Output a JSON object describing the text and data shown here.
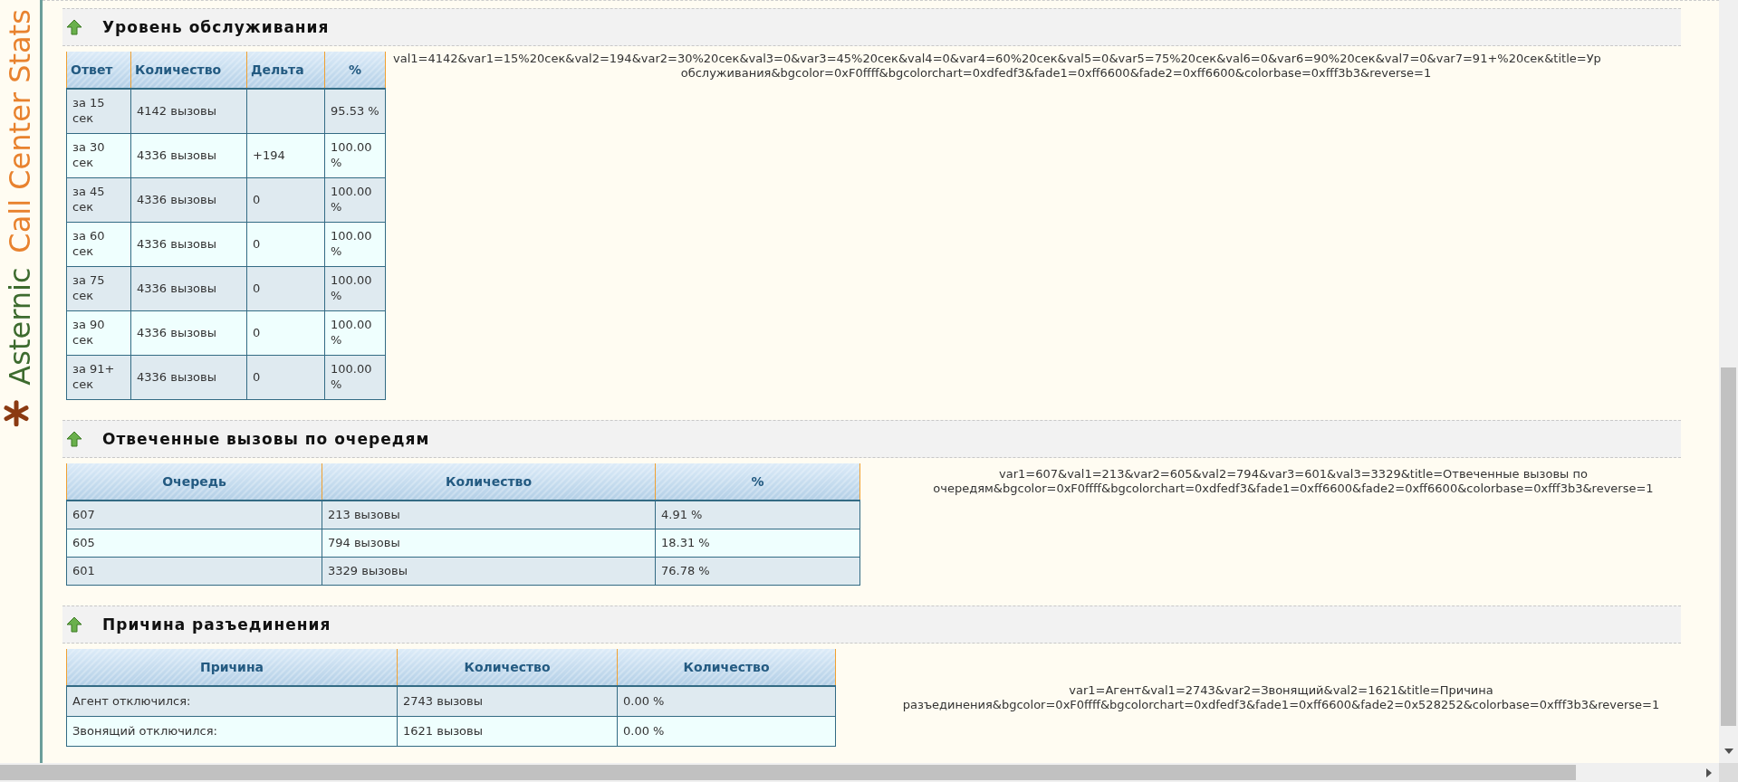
{
  "logo": {
    "brand": "Asternic",
    "product": "Call Center Stats"
  },
  "sections": [
    {
      "title": "Уровень обслуживания",
      "table": {
        "columns": [
          "Ответ",
          "Количество",
          "Дельта",
          "%"
        ],
        "rows": [
          [
            "за 15 сек",
            "4142 вызовы",
            "",
            "95.53 %"
          ],
          [
            "за 30 сек",
            "4336 вызовы",
            "+194",
            "100.00 %"
          ],
          [
            "за 45 сек",
            "4336 вызовы",
            "0",
            "100.00 %"
          ],
          [
            "за 60 сек",
            "4336 вызовы",
            "0",
            "100.00 %"
          ],
          [
            "за 75 сек",
            "4336 вызовы",
            "0",
            "100.00 %"
          ],
          [
            "за 90 сек",
            "4336 вызовы",
            "0",
            "100.00 %"
          ],
          [
            "за 91+ сек",
            "4336 вызовы",
            "0",
            "100.00 %"
          ]
        ]
      },
      "chart_params": [
        "val1=4142&var1=15%20сек&val2=194&var2=30%20сек&val3=0&var3=45%20сек&val4=0&var4=60%20сек&val5=0&var5=75%20сек&val6=0&var6=90%20сек&val7=0&var7=91+%20сек&title=Ур",
        "обслуживания&bgcolor=0xF0ffff&bgcolorchart=0xdfedf3&fade1=0xff6600&fade2=0xff6600&colorbase=0xfff3b3&reverse=1"
      ]
    },
    {
      "title": "Отвеченные вызовы по очередям",
      "table": {
        "columns": [
          "Очередь",
          "Количество",
          "%"
        ],
        "rows": [
          [
            "607",
            "213 вызовы",
            "4.91 %"
          ],
          [
            "605",
            "794 вызовы",
            "18.31 %"
          ],
          [
            "601",
            "3329 вызовы",
            "76.78 %"
          ]
        ]
      },
      "chart_params": [
        "var1=607&val1=213&var2=605&val2=794&var3=601&val3=3329&title=Отвеченные вызовы по",
        "очередям&bgcolor=0xF0ffff&bgcolorchart=0xdfedf3&fade1=0xff6600&fade2=0xff6600&colorbase=0xfff3b3&reverse=1"
      ]
    },
    {
      "title": "Причина разъединения",
      "table": {
        "columns": [
          "Причина",
          "Количество",
          "Количество"
        ],
        "rows": [
          [
            "Агент отключился:",
            "2743 вызовы",
            "0.00 %"
          ],
          [
            "Звонящий отключился:",
            "1621 вызовы",
            "0.00 %"
          ]
        ]
      },
      "chart_params": [
        "var1=Агент&val1=2743&var2=Звонящий&val2=1621&title=Причина",
        "разъединения&bgcolor=0xF0ffff&bgcolorchart=0xdfedf3&fade1=0xff6600&fade2=0x528252&colorbase=0xfff3b3&reverse=1"
      ]
    }
  ]
}
